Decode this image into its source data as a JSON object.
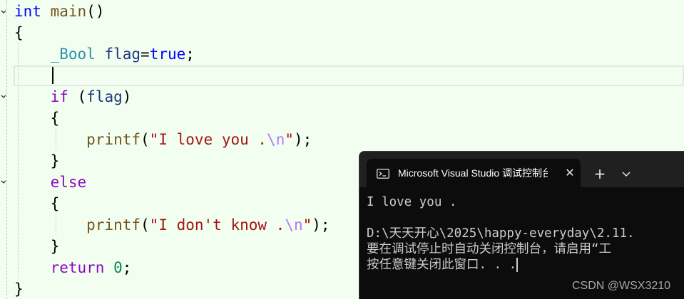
{
  "editor": {
    "line1": {
      "kw": "int",
      "fn": "main",
      "punct": "()"
    },
    "line2": {
      "brace": "{"
    },
    "line3": {
      "type": "_Bool",
      "var": "flag",
      "op": "=",
      "val": "true",
      "end": ";"
    },
    "line5": {
      "kw": "if",
      "open": " (",
      "var": "flag",
      "close": ")"
    },
    "line6": {
      "brace": "{"
    },
    "line7": {
      "fn": "printf",
      "open": "(",
      "str": "\"I love you .",
      "esc": "\\n",
      "strend": "\"",
      "close": ");"
    },
    "line8": {
      "brace": "}"
    },
    "line9": {
      "kw": "else"
    },
    "line10": {
      "brace": "{"
    },
    "line11": {
      "fn": "printf",
      "open": "(",
      "str": "\"I don't know .",
      "esc": "\\n",
      "strend": "\"",
      "close": ");"
    },
    "line12": {
      "brace": "}"
    },
    "line13": {
      "kw": "return",
      "num": "0",
      "end": ";"
    },
    "line14": {
      "brace": "}"
    }
  },
  "console": {
    "tab_title": "Microsoft Visual Studio 调试控制台",
    "tab_icon": "terminal-icon",
    "close_symbol": "✕",
    "new_tab_symbol": "+",
    "dropdown_icon": "chevron-down-icon",
    "lines": [
      "I love you .",
      "",
      "D:\\天天开心\\2025\\happy-everyday\\2.11.",
      "要在调试停止时自动关闭控制台，请启用“工",
      "按任意键关闭此窗口. . ."
    ]
  },
  "watermark": "CSDN @WSX3210",
  "colors": {
    "editor_bg": "#f2fff0",
    "keyword": "#0000ff",
    "control_keyword": "#8f08c4",
    "type": "#2b91af",
    "identifier": "#1f377f",
    "function": "#74531f",
    "string": "#a31515",
    "escape": "#b776fb",
    "console_bg": "#0c0c0c",
    "console_text": "#cccccc"
  }
}
